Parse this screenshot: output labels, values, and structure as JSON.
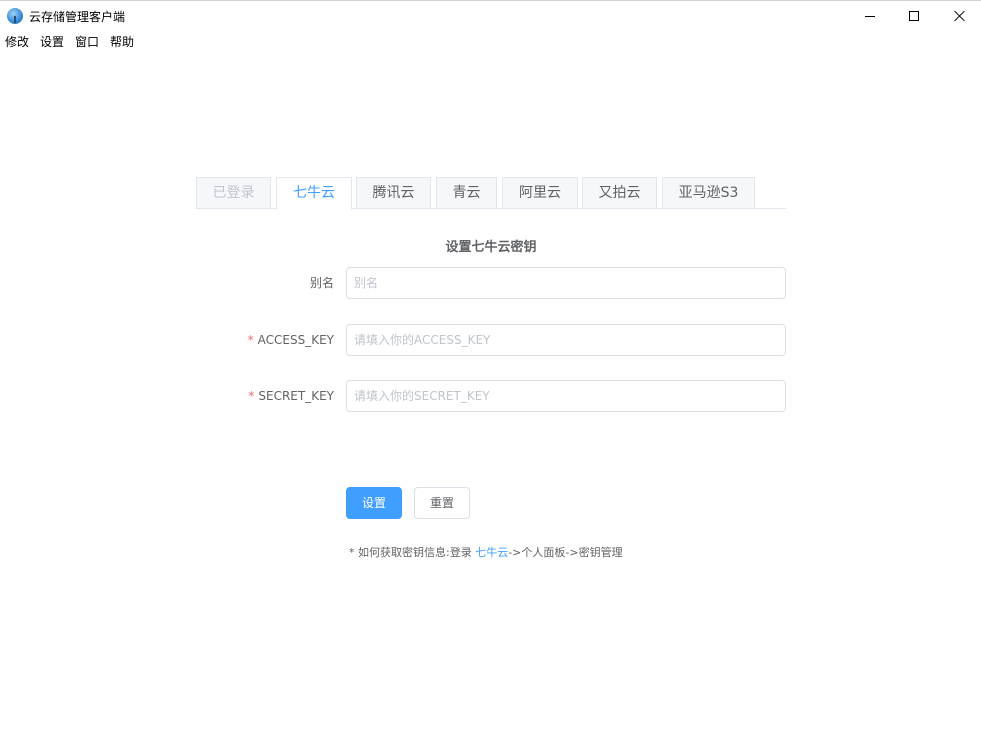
{
  "window": {
    "title": "云存储管理客户端",
    "icon": "globe-icon"
  },
  "menu": [
    "修改",
    "设置",
    "窗口",
    "帮助"
  ],
  "tabs": [
    {
      "label": "已登录",
      "state": "disabled"
    },
    {
      "label": "七牛云",
      "state": "active"
    },
    {
      "label": "腾讯云",
      "state": "normal"
    },
    {
      "label": "青云",
      "state": "normal"
    },
    {
      "label": "阿里云",
      "state": "normal"
    },
    {
      "label": "又拍云",
      "state": "normal"
    },
    {
      "label": "亚马逊S3",
      "state": "normal"
    }
  ],
  "form": {
    "title": "设置七牛云密钥",
    "fields": [
      {
        "label": "别名",
        "required": false,
        "placeholder": "别名",
        "value": ""
      },
      {
        "label": "ACCESS_KEY",
        "required": true,
        "placeholder": "请填入你的ACCESS_KEY",
        "value": ""
      },
      {
        "label": "SECRET_KEY",
        "required": true,
        "placeholder": "请填入你的SECRET_KEY",
        "value": ""
      }
    ],
    "required_mark": "*",
    "submit_label": "设置",
    "reset_label": "重置"
  },
  "hint": {
    "prefix": "* 如何获取密钥信息:登录 ",
    "link": "七牛云",
    "suffix": "->个人面板->密钥管理"
  },
  "colors": {
    "accent": "#409eff",
    "required": "#f56c6c",
    "border": "#dcdfe6",
    "text": "#606266",
    "placeholder": "#c0c4cc"
  }
}
